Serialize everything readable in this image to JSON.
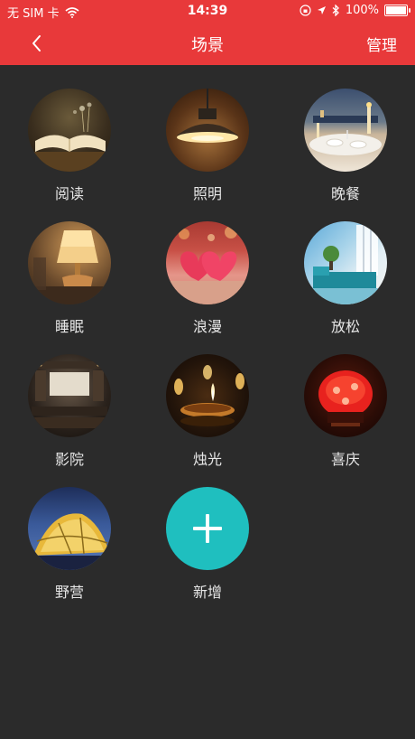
{
  "status_bar": {
    "carrier": "无 SIM 卡",
    "time": "14:39",
    "battery": "100%"
  },
  "navbar": {
    "title": "场景",
    "manage_label": "管理"
  },
  "scenes": [
    {
      "label": "阅读",
      "image": "open-book-photo"
    },
    {
      "label": "照明",
      "image": "pendant-lamp-photo"
    },
    {
      "label": "晚餐",
      "image": "dinner-table-photo"
    },
    {
      "label": "睡眠",
      "image": "bedside-lamp-photo"
    },
    {
      "label": "浪漫",
      "image": "hearts-photo"
    },
    {
      "label": "放松",
      "image": "living-room-photo"
    },
    {
      "label": "影院",
      "image": "home-theater-photo"
    },
    {
      "label": "烛光",
      "image": "candles-photo"
    },
    {
      "label": "喜庆",
      "image": "red-lantern-photo"
    },
    {
      "label": "野营",
      "image": "tent-photo"
    }
  ],
  "add_button": {
    "label": "新增",
    "icon": "plus-icon",
    "color": "#1fbfbf"
  },
  "colors": {
    "header": "#e8393a",
    "background": "#2b2b2b"
  }
}
